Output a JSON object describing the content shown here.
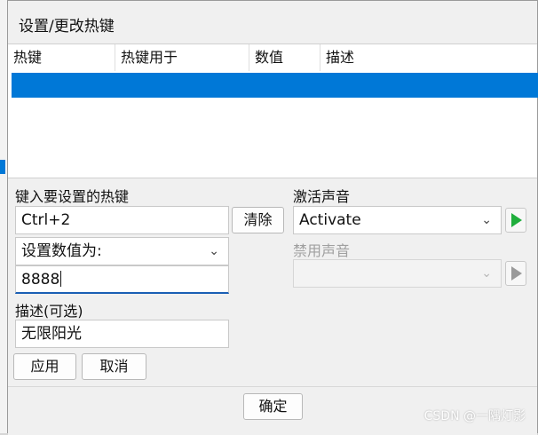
{
  "dialog": {
    "title": "设置/更改热键"
  },
  "hotkey_list": {
    "columns": [
      "热键",
      "热键用于",
      "数值",
      "描述"
    ]
  },
  "form": {
    "hotkey_label": "键入要设置的热键",
    "hotkey_value": "Ctrl+2",
    "clear_button": "清除",
    "action_select_value": "设置数值为:",
    "value_field": "8888",
    "description_label": "描述(可选)",
    "description_value": "无限阳光",
    "apply_button": "应用",
    "cancel_button": "取消",
    "activate_sound_label": "激活声音",
    "activate_sound_value": "Activate",
    "deactivate_sound_label": "禁用声音",
    "deactivate_sound_value": ""
  },
  "footer": {
    "ok_button": "确定"
  },
  "watermark": "CSDN @一隅灯影",
  "colors": {
    "selection": "#0078d7",
    "play_icon": "#1fae3c"
  }
}
